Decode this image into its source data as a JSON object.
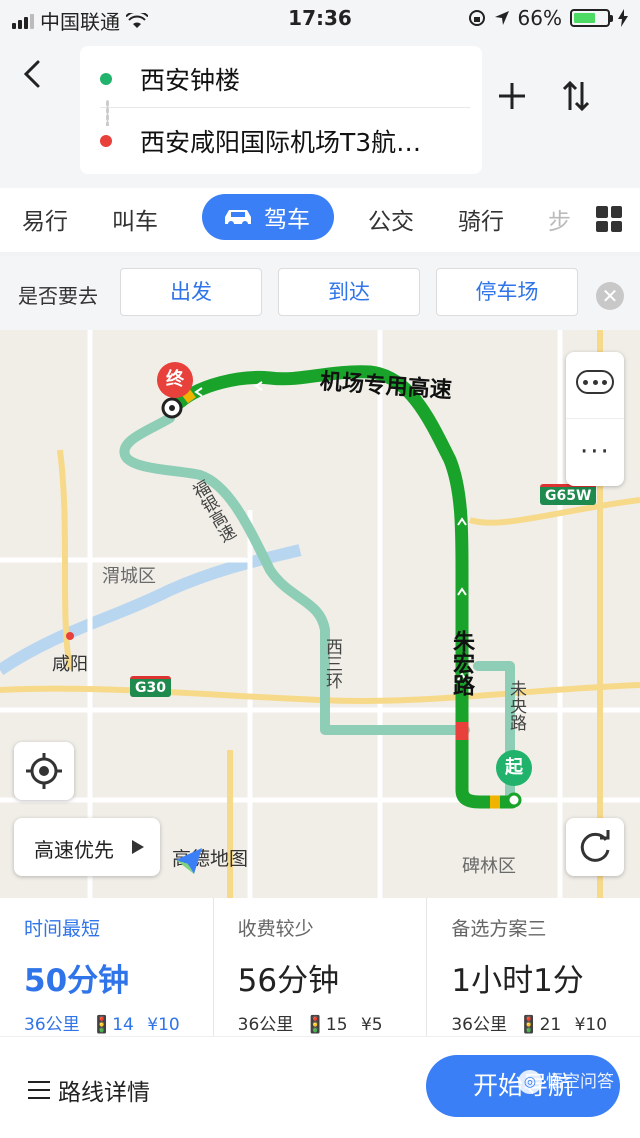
{
  "status_bar": {
    "carrier": "中国联通",
    "time": "17:36",
    "battery": "66%",
    "battery_level": 0.66
  },
  "route": {
    "origin": "西安钟楼",
    "destination": "西安咸阳国际机场T3航…"
  },
  "mode_tabs": [
    {
      "label": "易行",
      "active": false
    },
    {
      "label": "叫车",
      "active": false
    },
    {
      "label": "驾车",
      "active": true
    },
    {
      "label": "公交",
      "active": false
    },
    {
      "label": "骑行",
      "active": false
    },
    {
      "label": "步",
      "active": false
    }
  ],
  "quick_bar": {
    "label": "是否要去",
    "buttons": [
      "出发",
      "到达",
      "停车场"
    ]
  },
  "map": {
    "labels": {
      "weicheng": "渭城区",
      "xianyang": "咸阳",
      "beilin": "碑林区",
      "logo": "高德地图"
    },
    "shields": [
      "G65W",
      "G30"
    ],
    "roads": {
      "airport_expressway": "机场专用高速",
      "zhuhong_road": "朱宏路",
      "fuyin_expressway": "福银高速",
      "west_3rd_ring": "西三环",
      "weiyang_road": "未央路"
    },
    "pins": {
      "end": "终",
      "start": "起"
    },
    "highway_pref": "高速优先"
  },
  "route_options": [
    {
      "title": "时间最短",
      "time": "50分钟",
      "distance": "36公里",
      "lights": "14",
      "fee": "¥10",
      "active": true
    },
    {
      "title": "收费较少",
      "time": "56分钟",
      "distance": "36公里",
      "lights": "15",
      "fee": "¥5",
      "active": false
    },
    {
      "title": "备选方案三",
      "time": "1小时1分",
      "distance": "36公里",
      "lights": "21",
      "fee": "¥10",
      "active": false
    }
  ],
  "bottom": {
    "details": "路线详情",
    "navigate": "开始导航",
    "watermark": "悟空问答"
  },
  "colors": {
    "accent": "#3a7ff6",
    "route_main": "#1aa32a",
    "route_alt": "#8ecdb6",
    "start": "#21b36b",
    "end": "#e8403a"
  }
}
